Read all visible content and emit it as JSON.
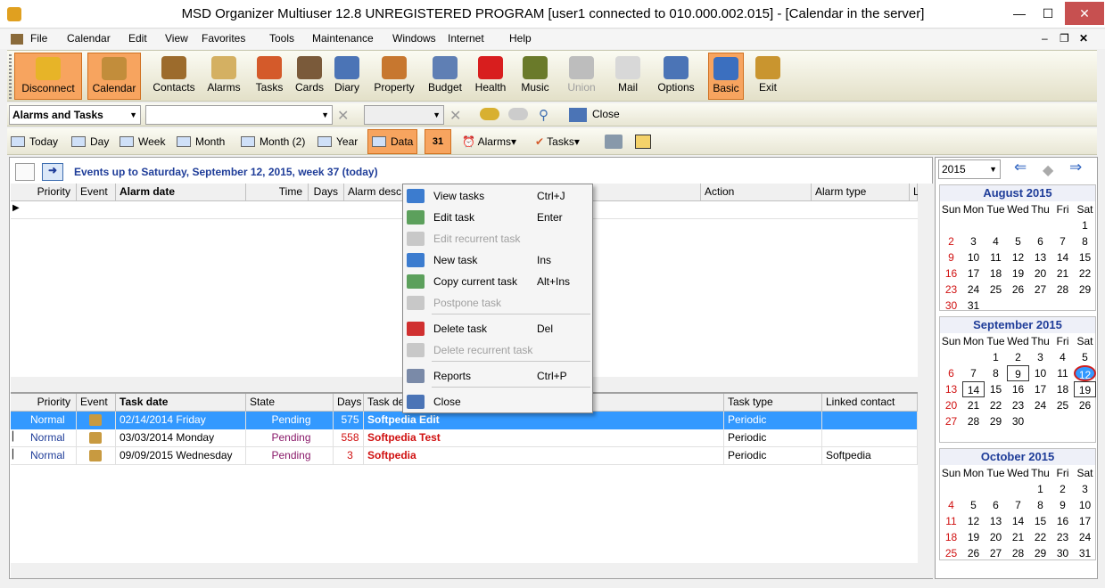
{
  "window": {
    "title": "MSD Organizer Multiuser 12.8 UNREGISTERED PROGRAM [user1 connected to 010.000.002.015] - [Calendar in the server]",
    "min": "—",
    "max": "☐",
    "close": "✕"
  },
  "menu": [
    "File",
    "Calendar",
    "Edit",
    "View",
    "Favorites",
    "Tools",
    "Maintenance",
    "Windows",
    "Internet",
    "Help"
  ],
  "toolbar": [
    {
      "label": "Disconnect",
      "color": "#e7b428",
      "active": true
    },
    {
      "label": "Calendar",
      "color": "#c28d3b",
      "active": true
    },
    {
      "label": "Contacts",
      "color": "#9c6b2c"
    },
    {
      "label": "Alarms",
      "color": "#d4b062"
    },
    {
      "label": "Tasks",
      "color": "#d45a2a"
    },
    {
      "label": "Cards",
      "color": "#7a5a3a"
    },
    {
      "label": "Diary",
      "color": "#4b74b6"
    },
    {
      "label": "Property",
      "color": "#c7772f"
    },
    {
      "label": "Budget",
      "color": "#5f7fb4"
    },
    {
      "label": "Health",
      "color": "#d81e1e"
    },
    {
      "label": "Music",
      "color": "#6a7a2a"
    },
    {
      "label": "Union",
      "color": "#bdbdbd",
      "disabled": true
    },
    {
      "label": "Mail",
      "color": "#d8d8d8"
    },
    {
      "label": "Options",
      "color": "#4b74b6"
    },
    {
      "label": "Basic",
      "color": "#3b6fbf",
      "active": true
    },
    {
      "label": "Exit",
      "color": "#c9952f"
    }
  ],
  "row2": {
    "module_select": "Alarms and Tasks",
    "close_label": "Close"
  },
  "row3": {
    "views": [
      "Today",
      "Day",
      "Week",
      "Month",
      "Month (2)",
      "Year",
      "Data"
    ],
    "alarms_label": "Alarms",
    "tasks_label": "Tasks",
    "day_icon": "31"
  },
  "events_header": "Events up to Saturday, September 12, 2015, week 37 (today)",
  "alarm_grid": {
    "columns": [
      "Priority",
      "Event",
      "Alarm date",
      "Time",
      "Days",
      "Alarm desc",
      "Action",
      "Alarm type",
      "L"
    ]
  },
  "task_grid": {
    "columns": [
      "Priority",
      "Event",
      "Task date",
      "State",
      "Days",
      "Task de",
      "Task type",
      "Linked contact"
    ],
    "rows": [
      {
        "priority": "Normal",
        "date": "02/14/2014 Friday",
        "state": "Pending",
        "days": "575",
        "desc": "Softpedia Edit",
        "type": "Periodic",
        "contact": ""
      },
      {
        "priority": "Normal",
        "date": "03/03/2014 Monday",
        "state": "Pending",
        "days": "558",
        "desc": "Softpedia Test",
        "type": "Periodic",
        "contact": ""
      },
      {
        "priority": "Normal",
        "date": "09/09/2015 Wednesday",
        "state": "Pending",
        "days": "3",
        "desc": "Softpedia",
        "type": "Periodic",
        "contact": "Softpedia"
      }
    ]
  },
  "context_menu": [
    {
      "label": "View tasks",
      "key": "Ctrl+J",
      "color": "#3c7ccf"
    },
    {
      "label": "Edit task",
      "key": "Enter",
      "color": "#5ca05c"
    },
    {
      "label": "Edit recurrent task",
      "key": "",
      "disabled": true,
      "color": "#c8c8c8"
    },
    {
      "label": "New task",
      "key": "Ins",
      "color": "#3c7ccf"
    },
    {
      "label": "Copy current task",
      "key": "Alt+Ins",
      "color": "#5ca05c"
    },
    {
      "label": "Postpone task",
      "key": "",
      "disabled": true,
      "color": "#c8c8c8"
    },
    {
      "label": "Delete task",
      "key": "Del",
      "color": "#d03030"
    },
    {
      "label": "Delete recurrent task",
      "key": "",
      "disabled": true,
      "color": "#c8c8c8"
    },
    {
      "label": "Reports",
      "key": "Ctrl+P",
      "color": "#7a8aa8"
    },
    {
      "label": "Close",
      "key": "",
      "color": "#4b74b6"
    }
  ],
  "year_select": "2015",
  "weekdays": [
    "Sun",
    "Mon",
    "Tue",
    "Wed",
    "Thu",
    "Fri",
    "Sat"
  ],
  "months": [
    {
      "name": "August 2015",
      "offset": 6,
      "days": 31,
      "boxed": []
    },
    {
      "name": "September 2015",
      "offset": 2,
      "days": 30,
      "boxed": [
        9,
        14,
        19
      ],
      "today": 12
    },
    {
      "name": "October 2015",
      "offset": 4,
      "days": 31,
      "boxed": []
    }
  ]
}
